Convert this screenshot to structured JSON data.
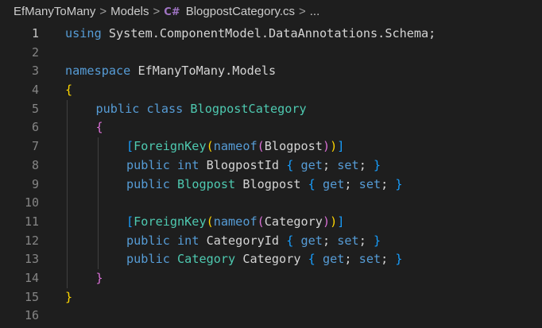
{
  "breadcrumb": {
    "project": "EfManyToMany",
    "folder": "Models",
    "file_icon": "C#",
    "file": "BlogpostCategory.cs",
    "trail": "...",
    "separator": ">"
  },
  "editor": {
    "active_line": 1,
    "lines": [
      {
        "no": "1",
        "indent": 0,
        "tokens": [
          {
            "t": "using",
            "c": "kw"
          },
          {
            "t": " System.ComponentModel.DataAnnotations.Schema;",
            "c": "pl"
          }
        ]
      },
      {
        "no": "2",
        "indent": 0,
        "tokens": []
      },
      {
        "no": "3",
        "indent": 0,
        "tokens": [
          {
            "t": "namespace",
            "c": "kw"
          },
          {
            "t": " EfManyToMany.Models",
            "c": "pl"
          }
        ]
      },
      {
        "no": "4",
        "indent": 0,
        "tokens": [
          {
            "t": "{",
            "c": "b1"
          }
        ]
      },
      {
        "no": "5",
        "indent": 1,
        "tokens": [
          {
            "t": "public",
            "c": "kw"
          },
          {
            "t": " ",
            "c": "pl"
          },
          {
            "t": "class",
            "c": "kw"
          },
          {
            "t": " ",
            "c": "pl"
          },
          {
            "t": "BlogpostCategory",
            "c": "ty"
          }
        ]
      },
      {
        "no": "6",
        "indent": 1,
        "tokens": [
          {
            "t": "{",
            "c": "b2"
          }
        ]
      },
      {
        "no": "7",
        "indent": 2,
        "tokens": [
          {
            "t": "[",
            "c": "b3"
          },
          {
            "t": "ForeignKey",
            "c": "ty"
          },
          {
            "t": "(",
            "c": "b1"
          },
          {
            "t": "nameof",
            "c": "kw"
          },
          {
            "t": "(",
            "c": "b2"
          },
          {
            "t": "Blogpost",
            "c": "pl"
          },
          {
            "t": ")",
            "c": "b2"
          },
          {
            "t": ")",
            "c": "b1"
          },
          {
            "t": "]",
            "c": "b3"
          }
        ]
      },
      {
        "no": "8",
        "indent": 2,
        "tokens": [
          {
            "t": "public",
            "c": "kw"
          },
          {
            "t": " ",
            "c": "pl"
          },
          {
            "t": "int",
            "c": "kw"
          },
          {
            "t": " BlogpostId ",
            "c": "pl"
          },
          {
            "t": "{",
            "c": "b3"
          },
          {
            "t": " ",
            "c": "pl"
          },
          {
            "t": "get",
            "c": "kw"
          },
          {
            "t": "; ",
            "c": "pl"
          },
          {
            "t": "set",
            "c": "kw"
          },
          {
            "t": "; ",
            "c": "pl"
          },
          {
            "t": "}",
            "c": "b3"
          }
        ]
      },
      {
        "no": "9",
        "indent": 2,
        "tokens": [
          {
            "t": "public",
            "c": "kw"
          },
          {
            "t": " ",
            "c": "pl"
          },
          {
            "t": "Blogpost",
            "c": "ty"
          },
          {
            "t": " Blogpost ",
            "c": "pl"
          },
          {
            "t": "{",
            "c": "b3"
          },
          {
            "t": " ",
            "c": "pl"
          },
          {
            "t": "get",
            "c": "kw"
          },
          {
            "t": "; ",
            "c": "pl"
          },
          {
            "t": "set",
            "c": "kw"
          },
          {
            "t": "; ",
            "c": "pl"
          },
          {
            "t": "}",
            "c": "b3"
          }
        ]
      },
      {
        "no": "10",
        "indent": 2,
        "tokens": []
      },
      {
        "no": "11",
        "indent": 2,
        "tokens": [
          {
            "t": "[",
            "c": "b3"
          },
          {
            "t": "ForeignKey",
            "c": "ty"
          },
          {
            "t": "(",
            "c": "b1"
          },
          {
            "t": "nameof",
            "c": "kw"
          },
          {
            "t": "(",
            "c": "b2"
          },
          {
            "t": "Category",
            "c": "pl"
          },
          {
            "t": ")",
            "c": "b2"
          },
          {
            "t": ")",
            "c": "b1"
          },
          {
            "t": "]",
            "c": "b3"
          }
        ]
      },
      {
        "no": "12",
        "indent": 2,
        "tokens": [
          {
            "t": "public",
            "c": "kw"
          },
          {
            "t": " ",
            "c": "pl"
          },
          {
            "t": "int",
            "c": "kw"
          },
          {
            "t": " CategoryId ",
            "c": "pl"
          },
          {
            "t": "{",
            "c": "b3"
          },
          {
            "t": " ",
            "c": "pl"
          },
          {
            "t": "get",
            "c": "kw"
          },
          {
            "t": "; ",
            "c": "pl"
          },
          {
            "t": "set",
            "c": "kw"
          },
          {
            "t": "; ",
            "c": "pl"
          },
          {
            "t": "}",
            "c": "b3"
          }
        ]
      },
      {
        "no": "13",
        "indent": 2,
        "tokens": [
          {
            "t": "public",
            "c": "kw"
          },
          {
            "t": " ",
            "c": "pl"
          },
          {
            "t": "Category",
            "c": "ty"
          },
          {
            "t": " Category ",
            "c": "pl"
          },
          {
            "t": "{",
            "c": "b3"
          },
          {
            "t": " ",
            "c": "pl"
          },
          {
            "t": "get",
            "c": "kw"
          },
          {
            "t": "; ",
            "c": "pl"
          },
          {
            "t": "set",
            "c": "kw"
          },
          {
            "t": "; ",
            "c": "pl"
          },
          {
            "t": "}",
            "c": "b3"
          }
        ]
      },
      {
        "no": "14",
        "indent": 1,
        "tokens": [
          {
            "t": "}",
            "c": "b2"
          }
        ]
      },
      {
        "no": "15",
        "indent": 0,
        "tokens": [
          {
            "t": "}",
            "c": "b1"
          }
        ]
      },
      {
        "no": "16",
        "indent": 0,
        "tokens": []
      }
    ]
  },
  "colors": {
    "background": "#1e1e1e",
    "keyword": "#569cd6",
    "type": "#4ec9b0",
    "plain": "#d4d4d4",
    "bracket_gold": "#ffd700",
    "bracket_orchid": "#da70d6",
    "bracket_blue": "#179fff",
    "line_number": "#858585"
  }
}
